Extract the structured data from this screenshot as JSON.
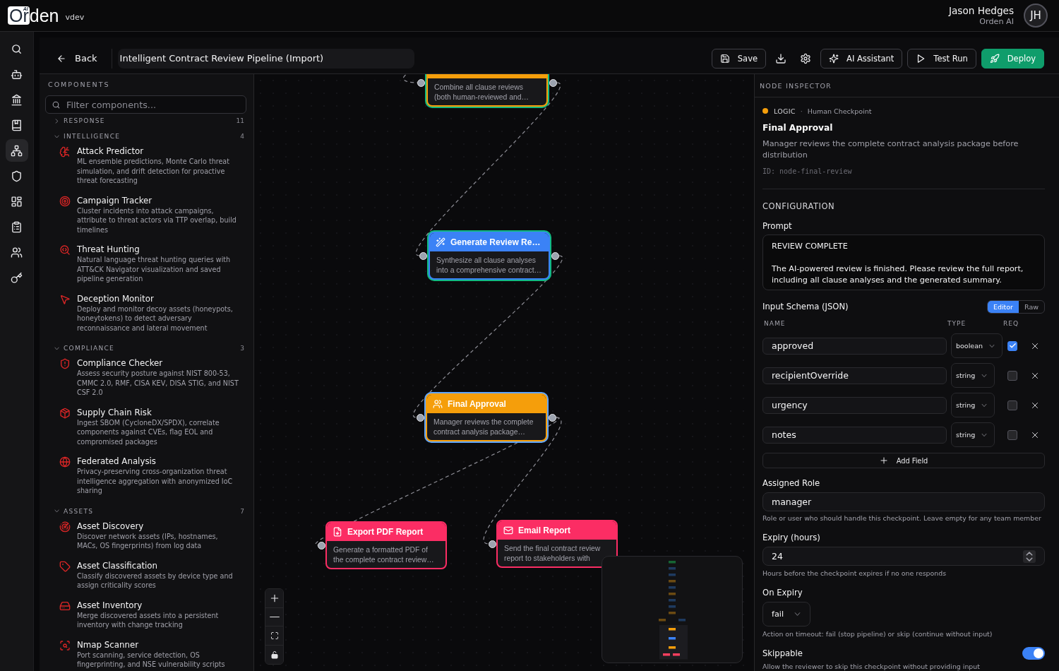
{
  "brand": {
    "boxed": "Or",
    "rest": "den",
    "badge": "AI",
    "version": "vdev"
  },
  "user": {
    "name": "Jason Hedges",
    "org": "Orden AI",
    "initials": "JH"
  },
  "rail": [
    {
      "selected": false
    },
    {
      "selected": false
    },
    {
      "selected": false
    },
    {
      "selected": false
    },
    {
      "selected": true
    },
    {
      "selected": false
    },
    {
      "selected": false
    },
    {
      "selected": false
    },
    {
      "selected": false
    },
    {
      "selected": false
    }
  ],
  "toolbar": {
    "back": "Back",
    "title": "Intelligent Contract Review Pipeline (Import)",
    "actions": [
      {
        "kind": "save",
        "label": "Save"
      },
      {
        "kind": "download"
      },
      {
        "kind": "settings"
      },
      {
        "kind": "ai",
        "label": "AI Assistant"
      },
      {
        "kind": "run",
        "label": "Test Run"
      },
      {
        "kind": "deploy",
        "label": "Deploy"
      }
    ]
  },
  "components": {
    "heading": "COMPONENTS",
    "filter": {
      "placeholder": "Filter components..."
    },
    "sections": [
      {
        "label": "RESPONSE",
        "count": "11",
        "expanded": false
      },
      {
        "label": "INTELLIGENCE",
        "count": "4",
        "expanded": true,
        "items": [
          {
            "title": "Attack Predictor",
            "description": "ML ensemble predictions, Monte Carlo threat simulation, and drift detection for proactive threat forecasting"
          },
          {
            "title": "Campaign Tracker",
            "description": "Cluster incidents into attack campaigns, attribute to threat actors via TTP overlap, build timelines"
          },
          {
            "title": "Threat Hunting",
            "description": "Natural language threat hunting queries with ATT&CK Navigator visualization and saved pipeline generation"
          },
          {
            "title": "Deception Monitor",
            "description": "Deploy and monitor decoy assets (honeypots, honeytokens) to detect adversary reconnaissance and lateral movement"
          }
        ]
      },
      {
        "label": "COMPLIANCE",
        "count": "3",
        "expanded": true,
        "items": [
          {
            "title": "Compliance Checker",
            "description": "Assess security posture against NIST 800-53, CMMC 2.0, RMF, CISA KEV, DISA STIG, and NIST CSF 2.0"
          },
          {
            "title": "Supply Chain Risk",
            "description": "Ingest SBOM (CycloneDX/SPDX), correlate components against CVEs, flag EOL and compromised packages"
          },
          {
            "title": "Federated Analysis",
            "description": "Privacy-preserving cross-organization threat intelligence aggregation with anonymized IoC sharing"
          }
        ]
      },
      {
        "label": "ASSETS",
        "count": "7",
        "expanded": true,
        "items": [
          {
            "title": "Asset Discovery",
            "description": "Discover network assets (IPs, hostnames, MACs, OS fingerprints) from log data"
          },
          {
            "title": "Asset Classification",
            "description": "Classify discovered assets by device type and assign criticality scores"
          },
          {
            "title": "Asset Inventory",
            "description": "Merge discovered assets into a persistent inventory with change tracking"
          },
          {
            "title": "Nmap Scanner",
            "description": "Port scanning, service detection, OS fingerprinting, and NSE vulnerability scripts"
          }
        ]
      }
    ]
  },
  "canvas": {
    "nodes": [
      {
        "kind": "merge",
        "description": "Combine all clause reviews (both human-reviewed and…",
        "completed": true,
        "selected": false
      },
      {
        "kind": "generate",
        "title": "Generate Review Re…",
        "description": "Synthesize all clause analyses into a comprehensive contract…",
        "completed": true,
        "selected": false
      },
      {
        "kind": "checkpoint",
        "title": "Final Approval",
        "description": "Manager reviews the complete contract analysis package…",
        "completed": false,
        "selected": true
      },
      {
        "kind": "export",
        "title": "Export PDF Report",
        "description": "Generate a formatted PDF of the complete contract review…",
        "completed": false,
        "selected": false
      },
      {
        "kind": "email",
        "title": "Email Report",
        "description": "Send the final contract review report to stakeholders with",
        "completed": false,
        "selected": false
      }
    ]
  },
  "inspector": {
    "heading": "NODE INSPECTOR",
    "kind": "checkpoint",
    "category": "LOGIC",
    "separator": "·",
    "node_type": "Human Checkpoint",
    "title": "Final Approval",
    "description": "Manager reviews the complete contract analysis package before distribution",
    "id_label": "ID: node-final-review",
    "section": "CONFIGURATION",
    "prompt": {
      "label": "Prompt",
      "value": "REVIEW COMPLETE\n\nThe AI-powered review is finished. Please review the full report, including all clause analyses and the generated summary."
    },
    "schema": {
      "label": "Input Schema (JSON)",
      "modes": [
        {
          "label": "Editor",
          "selected": true
        },
        {
          "label": "Raw",
          "selected": false
        }
      ],
      "columns": [
        "NAME",
        "TYPE",
        "REQ"
      ],
      "fields": [
        {
          "name": "approved",
          "type": "boolean",
          "required": true
        },
        {
          "name": "recipientOverride",
          "type": "string",
          "required": false
        },
        {
          "name": "urgency",
          "type": "string",
          "required": false
        },
        {
          "name": "notes",
          "type": "string",
          "required": false
        }
      ],
      "add_button": "Add Field"
    },
    "assigned_role": {
      "label": "Assigned Role",
      "value": "manager",
      "hint": "Role or user who should handle this checkpoint. Leave empty for any team member"
    },
    "expiry": {
      "label": "Expiry (hours)",
      "value": "24",
      "hint": "Hours before the checkpoint expires if no one responds"
    },
    "on_expiry": {
      "label": "On Expiry",
      "value": "fail",
      "hint": "Action on timeout: fail (stop pipeline) or skip (continue without input)"
    },
    "skippable": {
      "label": "Skippable",
      "on": true,
      "hint": "Allow the reviewer to skip this checkpoint without providing input"
    }
  }
}
